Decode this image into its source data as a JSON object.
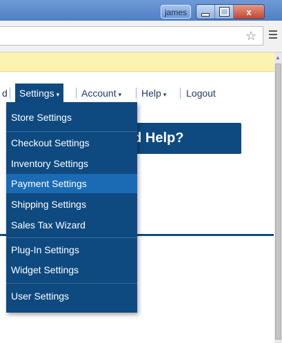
{
  "window": {
    "user_label": "james",
    "close_glyph": "x"
  },
  "browser": {
    "star_icon": "☆",
    "menu_icon": "hamburger-menu-icon"
  },
  "nav": {
    "left_fragment": "d",
    "items": [
      {
        "label": "Settings",
        "active": true
      },
      {
        "label": "Account",
        "active": false
      },
      {
        "label": "Help",
        "active": false
      },
      {
        "label": "Logout",
        "active": false
      }
    ],
    "caret": "▾"
  },
  "banner": {
    "text": "ed Help?"
  },
  "dropdown": {
    "items": [
      "Store Settings",
      "Checkout Settings",
      "Inventory Settings",
      "Payment Settings",
      "Shipping Settings",
      "Sales Tax Wizard",
      "Plug-In Settings",
      "Widget Settings",
      "User Settings"
    ],
    "hovered": "Payment Settings"
  },
  "colors": {
    "brand": "#0e4a80",
    "hover": "#1a6bb3",
    "infobar": "#fdf3b1"
  }
}
